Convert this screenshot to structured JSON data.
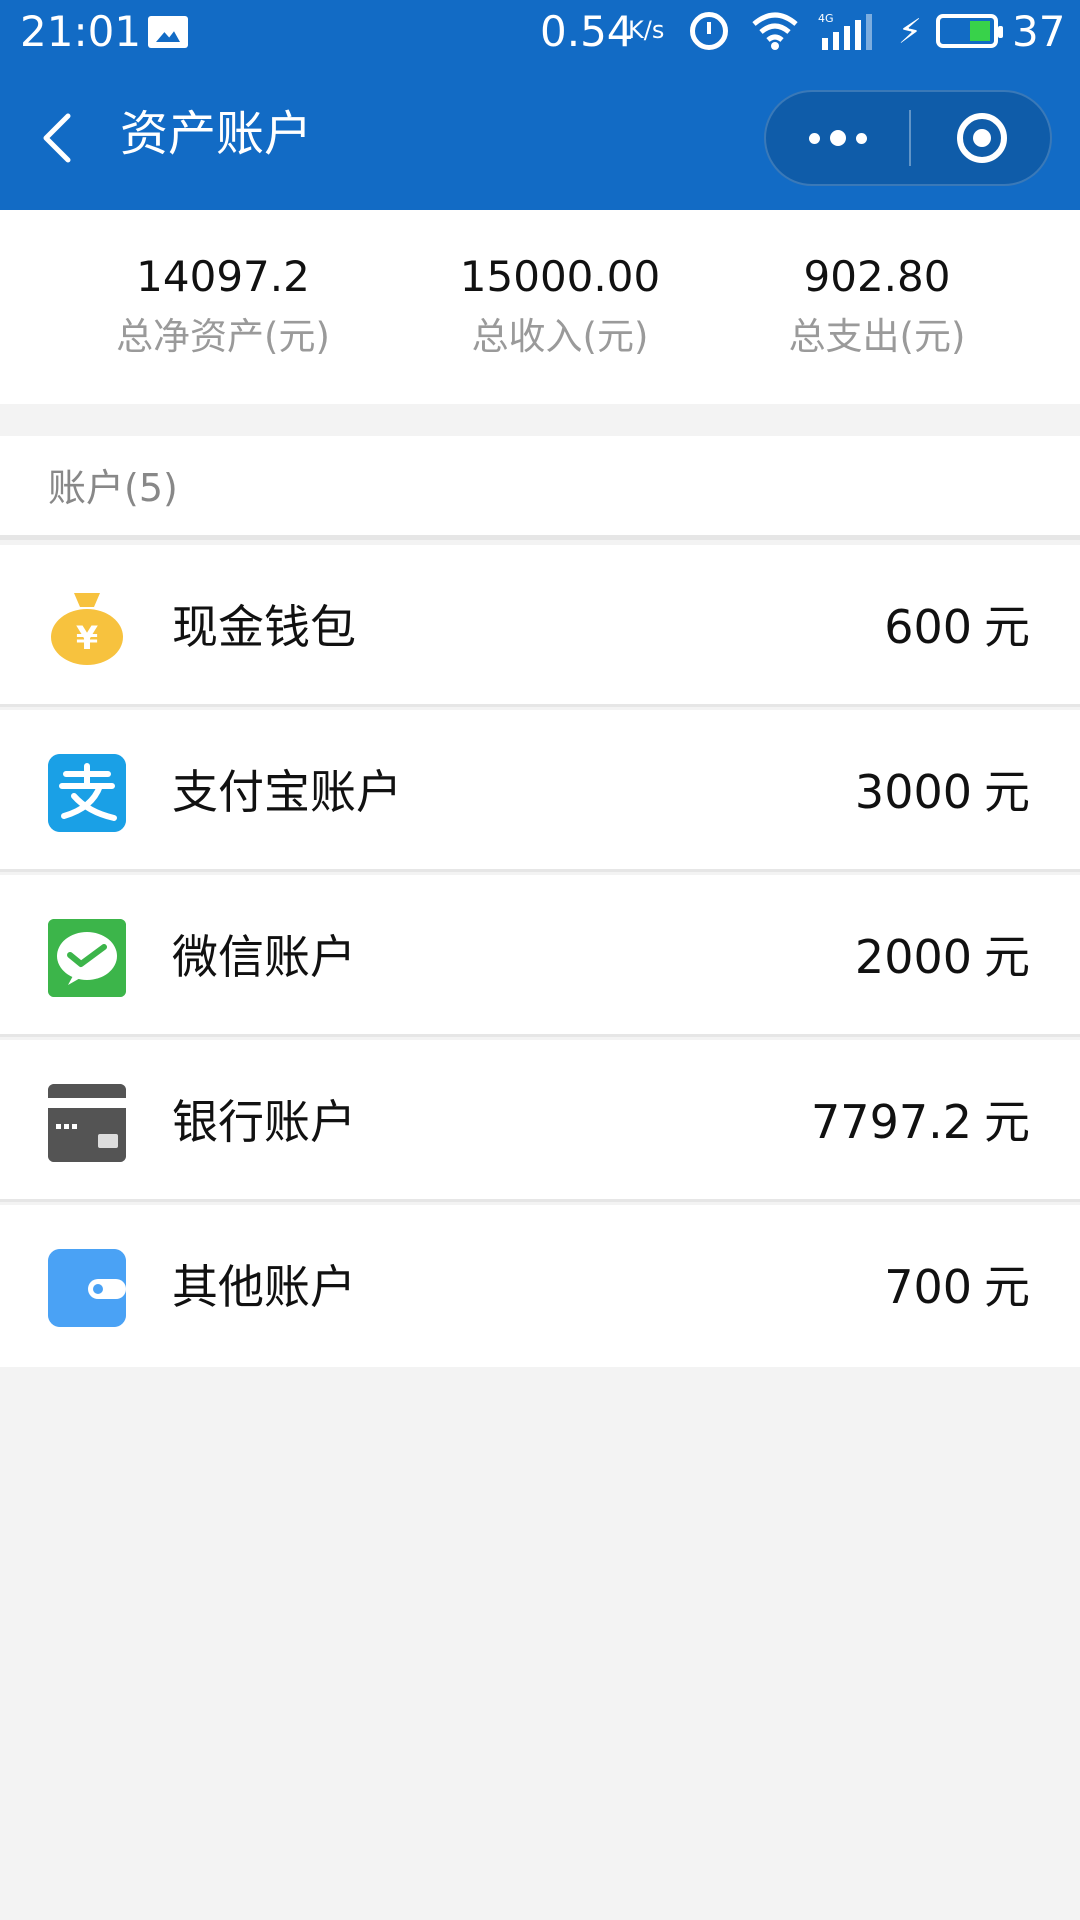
{
  "status_bar": {
    "time": "21:01",
    "speed": "0.54",
    "speed_unit": "K/s",
    "network": "4G",
    "battery": "37"
  },
  "nav": {
    "title": "资产账户"
  },
  "summary": {
    "net_assets": {
      "value": "14097.2",
      "label": "总净资产(元)"
    },
    "income": {
      "value": "15000.00",
      "label": "总收入(元)"
    },
    "expense": {
      "value": "902.80",
      "label": "总支出(元)"
    }
  },
  "accounts": {
    "header": "账户(5)",
    "items": [
      {
        "name": "现金钱包",
        "amount": "600",
        "unit": "元",
        "icon": "money-bag-icon"
      },
      {
        "name": "支付宝账户",
        "amount": "3000",
        "unit": "元",
        "icon": "alipay-icon"
      },
      {
        "name": "微信账户",
        "amount": "2000",
        "unit": "元",
        "icon": "wechat-icon"
      },
      {
        "name": "银行账户",
        "amount": "7797.2",
        "unit": "元",
        "icon": "bank-card-icon"
      },
      {
        "name": "其他账户",
        "amount": "700",
        "unit": "元",
        "icon": "wallet-icon"
      }
    ]
  },
  "colors": {
    "primary": "#126bc5",
    "background": "#f3f3f3",
    "money_bag": "#f7c23e",
    "alipay": "#1aa0e6",
    "wechat": "#3cb54a",
    "bank": "#545454",
    "other": "#4aa2f5"
  }
}
